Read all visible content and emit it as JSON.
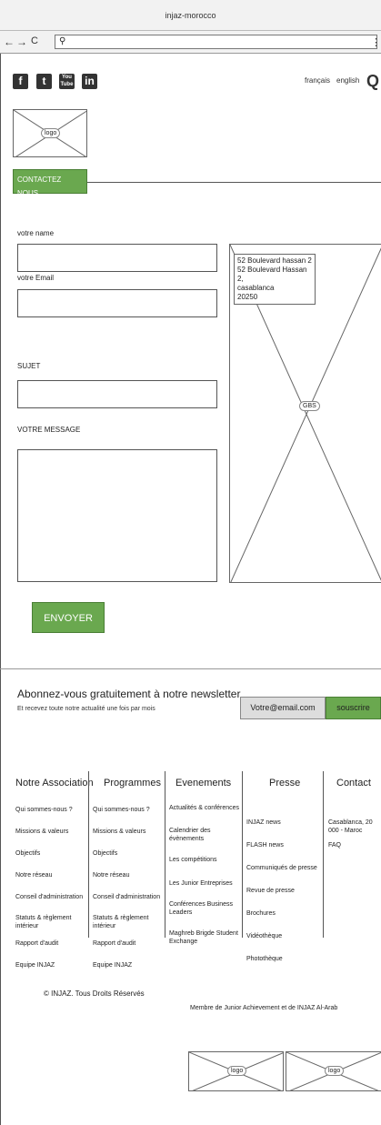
{
  "browser": {
    "title": "injaz-morocco",
    "back": "←",
    "forward": "→",
    "reload": "C",
    "search_glyph": "🔍"
  },
  "header": {
    "social": [
      {
        "name": "facebook-icon",
        "glyph": "f"
      },
      {
        "name": "twitter-icon",
        "glyph": "t"
      },
      {
        "name": "youtube-icon",
        "glyph": "You"
      },
      {
        "name": "linkedin-icon",
        "glyph": "in"
      }
    ],
    "lang_fr": "français",
    "lang_en": "english",
    "logo_label": "logo"
  },
  "contact": {
    "tab_label": "CONTACTEZ NOUS",
    "name_label": "votre name",
    "email_label": "votre Email",
    "subject_label": "SUJET",
    "message_label": "VOTRE MESSAGE",
    "send_label": "ENVOYER"
  },
  "map": {
    "address_lines": [
      "52 Boulevard hassan 2",
      "52 Boulevard Hassan 2,",
      "casablanca",
      "20250"
    ],
    "label": "GBS"
  },
  "newsletter": {
    "title": "Abonnez-vous gratuitement à notre newsletter",
    "subtitle": "Et recevez toute notre actualité une fois par mois",
    "email_placeholder": "Votre@email.com",
    "subscribe_label": "souscrire"
  },
  "footer": {
    "columns": [
      {
        "title": "Notre Association",
        "items": [
          "Qui sommes-nous ?",
          "Missions & valeurs",
          "Objectifs",
          "Notre réseau",
          "Conseil d'administration",
          "Statuts & règlement intérieur",
          "Rapport d'audit",
          "Equipe INJAZ"
        ]
      },
      {
        "title": "Programmes",
        "items": [
          "Qui sommes-nous ?",
          "Missions & valeurs",
          "Objectifs",
          "Notre réseau",
          "Conseil d'administration",
          "Statuts & règlement intérieur",
          "Rapport d'audit",
          "Equipe INJAZ"
        ]
      },
      {
        "title": "Evenements",
        "items": [
          "Actualités & conférences",
          "Calendrier des évènements",
          "Les compétitions",
          "Les Junior Entreprises",
          "Conférences Business Leaders",
          "Maghreb Brigde Student Exchange"
        ]
      },
      {
        "title": "Presse",
        "items": [
          "INJAZ news",
          "FLASH news",
          "Communiqués de presse",
          "Revue de presse",
          "Brochures",
          "Vidéothèque",
          "Photothèque"
        ]
      },
      {
        "title": "Contact",
        "items": [
          "Casablanca, 20 000 - Maroc",
          "FAQ"
        ]
      }
    ],
    "copyright": "© INJAZ. Tous Droits Réservés",
    "member": "Membre de Junior Achievement et de INJAZ Al-Arab",
    "logo1": "logo",
    "logo2": "logo"
  }
}
